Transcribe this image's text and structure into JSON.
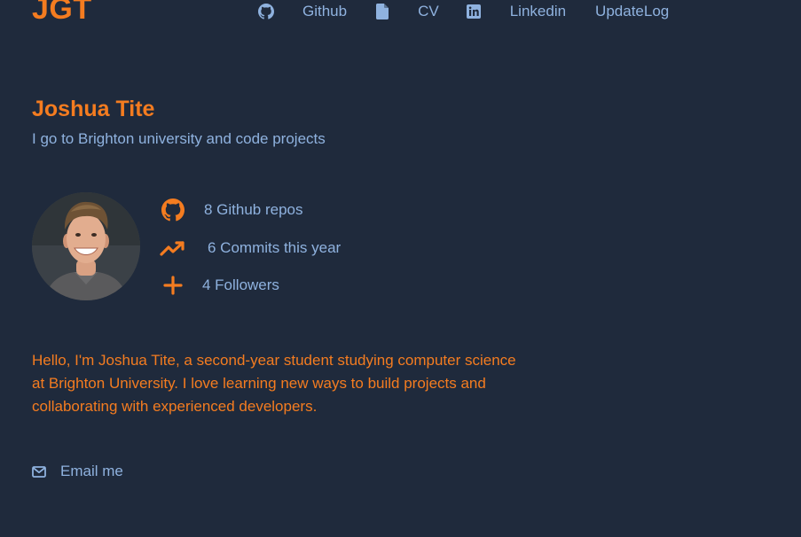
{
  "header": {
    "logo": "JGT",
    "nav": [
      {
        "label": "Github",
        "icon": "github-icon"
      },
      {
        "label": "CV",
        "icon": "file-icon"
      },
      {
        "label": "Linkedin",
        "icon": "linkedin-icon"
      },
      {
        "label": "UpdateLog"
      }
    ]
  },
  "profile": {
    "name": "Joshua Tite",
    "tagline": "I go to Brighton university and code projects",
    "avatar_icon": "profile-photo",
    "stats": [
      {
        "icon": "github-icon",
        "text": "8 Github repos"
      },
      {
        "icon": "trending-up-icon",
        "text": "6 Commits this year"
      },
      {
        "icon": "plus-icon",
        "text": "4 Followers"
      }
    ],
    "bio": "Hello, I'm Joshua Tite, a second-year student studying computer science at Brighton University. I love learning new ways to build projects and collaborating with experienced developers.",
    "email_label": "Email me",
    "email_icon": "envelope-icon"
  },
  "colors": {
    "background": "#1f2a3c",
    "accent": "#f47c20",
    "link": "#8fb2df"
  }
}
